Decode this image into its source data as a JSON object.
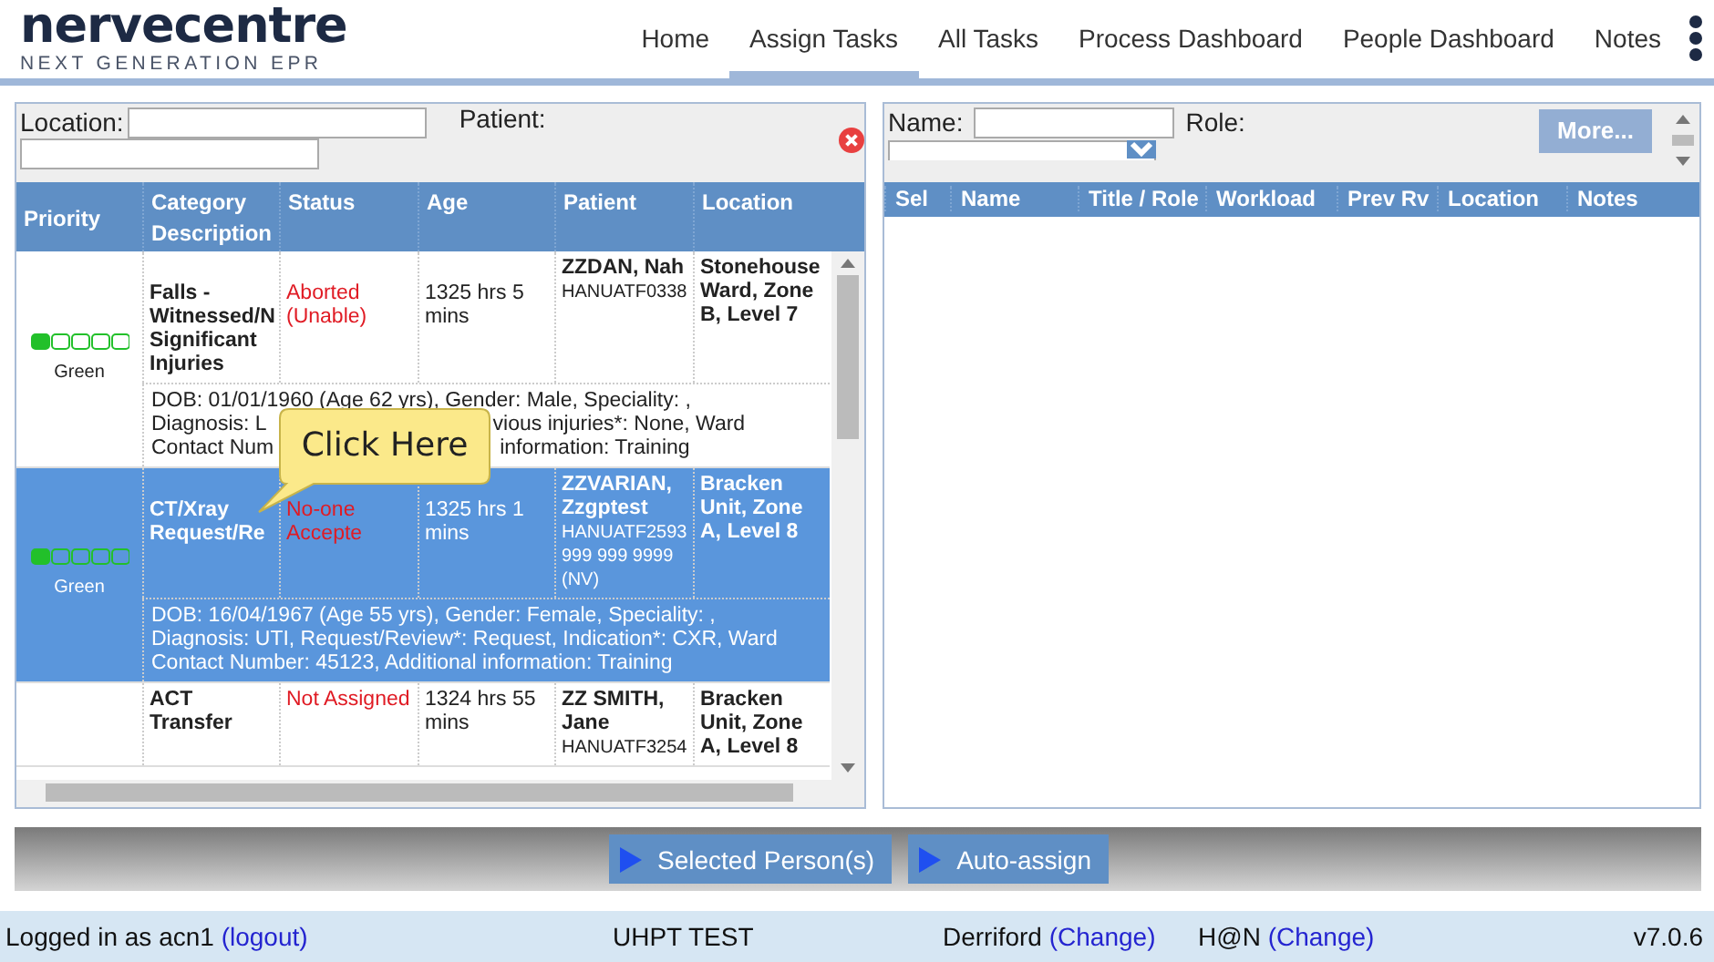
{
  "header": {
    "logo": {
      "name": "nervecentre",
      "tagline": "NEXT GENERATION EPR"
    },
    "nav": [
      {
        "label": "Home",
        "selected": false
      },
      {
        "label": "Assign Tasks",
        "selected": true
      },
      {
        "label": "All Tasks",
        "selected": false
      },
      {
        "label": "Process Dashboard",
        "selected": false
      },
      {
        "label": "People Dashboard",
        "selected": false
      },
      {
        "label": "Notes",
        "selected": false
      }
    ]
  },
  "task_panel": {
    "filters": [
      {
        "label": "Location:"
      },
      {
        "label": "Patient:"
      }
    ],
    "columns": [
      "Priority",
      "Category",
      "Status",
      "Age",
      "Patient",
      "Location"
    ],
    "description_heading": "Description",
    "rows": [
      {
        "selected": false,
        "priority": {
          "stars": 1,
          "label": "Green"
        },
        "category": "Falls - Witnessed/N Significant Injuries",
        "status": "Aborted (Unable)",
        "age": "1325 hrs 5 mins",
        "patient": "ZZDAN, Nah",
        "patient_ids": [
          "HANUATF0338"
        ],
        "location": "Stonehouse Ward, Zone B, Level 7",
        "description": [
          [
            "DOB: 01/01/1960 (Age 62 yrs), Gender: Male, Speciality: ,"
          ],
          [
            "Diagnosis: L",
            "vious injuries*: None, Ward"
          ],
          [
            "Contact Num",
            "information: Training"
          ]
        ]
      },
      {
        "selected": true,
        "priority": {
          "stars": 1,
          "label": "Green"
        },
        "category": "CT/Xray Request/Re",
        "status": "No-one Accepte",
        "age": "1325 hrs 1 mins",
        "patient": "ZZVARIAN, Zzgptest",
        "patient_ids": [
          "HANUATF2593",
          "999 999 9999",
          "(NV)"
        ],
        "location": "Bracken Unit, Zone A, Level 8",
        "description": [
          [
            "DOB: 16/04/1967 (Age 55 yrs), Gender: Female, Speciality: ,"
          ],
          [
            "Diagnosis: UTI, Request/Review*: Request, Indication*: CXR, Ward"
          ],
          [
            "Contact Number: 45123, Additional information: Training"
          ]
        ]
      },
      {
        "selected": false,
        "category": "ACT Transfer",
        "status": "Not Assigned",
        "age": "1324 hrs 55 mins",
        "patient": "ZZ SMITH, Jane",
        "patient_ids": [
          "HANUATF3254"
        ],
        "location": "Bracken Unit, Zone A, Level 8"
      }
    ]
  },
  "callout": {
    "text": "Click Here"
  },
  "people_panel": {
    "filters": [
      {
        "label": "Name:"
      },
      {
        "label": "Role:"
      }
    ],
    "buttons": [
      {
        "label": "More...",
        "disabled": true
      }
    ],
    "columns": [
      "Sel",
      "Name",
      "Title / Role",
      "Workload",
      "Prev Rv",
      "Location",
      "Notes"
    ]
  },
  "actions": [
    "Selected Person(s)",
    "Auto-assign"
  ],
  "status_bar": {
    "user": "Logged in as acn1",
    "logout": "(logout)",
    "site": "UHPT TEST",
    "hospital": "Derriford",
    "hospital_change": "(Change)",
    "area": "H@N",
    "area_change": "(Change)",
    "version": "v7.0.6"
  }
}
